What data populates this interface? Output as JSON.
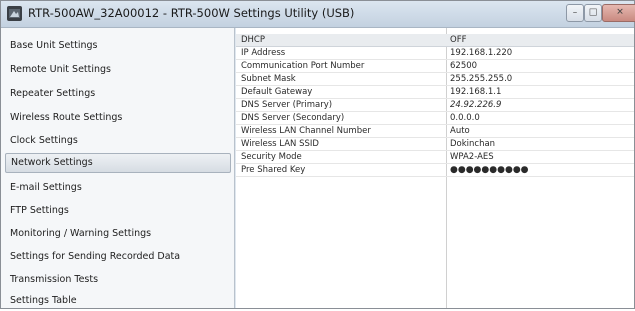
{
  "window": {
    "title": "RTR-500AW_32A00012 - RTR-500W Settings Utility (USB)",
    "controls": {
      "minimize": "–",
      "maximize": "□",
      "close": "✕"
    }
  },
  "sidebar": {
    "items": [
      {
        "label": "Base Unit Settings"
      },
      {
        "label": "Remote Unit Settings"
      },
      {
        "label": "Repeater Settings"
      },
      {
        "label": "Wireless Route Settings"
      },
      {
        "label": "Clock Settings"
      },
      {
        "label": "Network Settings",
        "selected": true
      },
      {
        "label": "E-mail Settings"
      },
      {
        "label": "FTP Settings"
      },
      {
        "label": "Monitoring / Warning Settings"
      },
      {
        "label": "Settings for Sending Recorded Data"
      },
      {
        "label": "Transmission Tests"
      },
      {
        "label": "Settings Table"
      }
    ]
  },
  "table": {
    "rows": [
      {
        "label": "DHCP",
        "value": "OFF"
      },
      {
        "label": "IP Address",
        "value": "192.168.1.220"
      },
      {
        "label": "Communication Port Number",
        "value": "62500"
      },
      {
        "label": "Subnet Mask",
        "value": "255.255.255.0"
      },
      {
        "label": "Default Gateway",
        "value": "192.168.1.1"
      },
      {
        "label": "DNS Server (Primary)",
        "value": "24.92.226.9"
      },
      {
        "label": "DNS Server (Secondary)",
        "value": "0.0.0.0"
      },
      {
        "label": "Wireless LAN Channel Number",
        "value": "Auto"
      },
      {
        "label": "Wireless LAN SSID",
        "value": "Dokinchan"
      },
      {
        "label": "Security Mode",
        "value": "WPA2-AES"
      },
      {
        "label": "Pre Shared Key",
        "value": "●●●●●●●●●●"
      }
    ]
  },
  "colors": {
    "selection": "#d6dce3",
    "header_row": "#e9ecef"
  }
}
